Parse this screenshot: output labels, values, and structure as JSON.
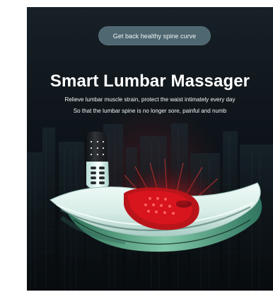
{
  "ad": {
    "pill": "Get back healthy spine curve",
    "title": "Smart Lumbar Massager",
    "subtitles": [
      "Relieve lumbar muscle strain, protect the waist intimately every day",
      "So that the lumbar spine is no longer sore, painful and numb"
    ]
  },
  "colors": {
    "page": "#ffffff",
    "background": "#111920",
    "pill": "#4f6770",
    "device_mint": "#dceeea",
    "device_green": "#64a98f",
    "heat_red": "#b9141a"
  },
  "icons": [
    "massager-device-icon",
    "remote-control-icon",
    "heat-glow-icon"
  ]
}
